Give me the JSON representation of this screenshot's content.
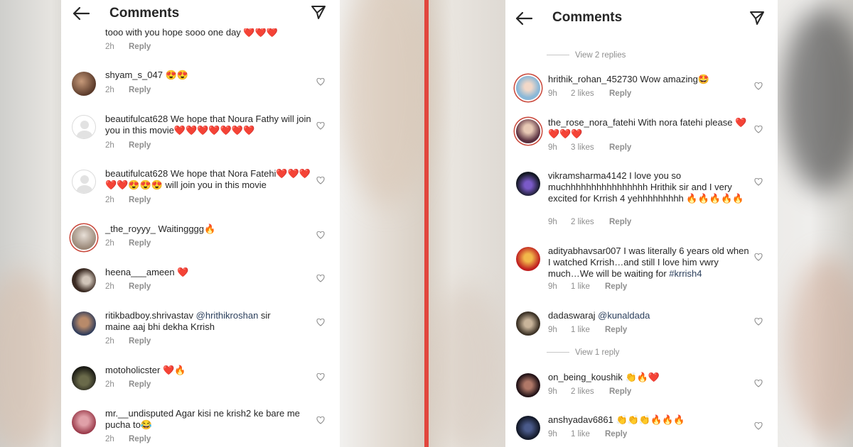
{
  "panels": [
    {
      "header": {
        "title": "Comments"
      },
      "comments": [
        {
          "text": "tooo with you hope sooo one day ❤️❤️❤️",
          "time": "2h",
          "reply": "Reply"
        },
        {
          "user": "shyam_s_047",
          "text": "😍😍",
          "time": "2h",
          "reply": "Reply"
        },
        {
          "user": "beautifulcat628",
          "text": "We hope that Noura Fathy will join you in this movie❤️❤️❤️❤️❤️❤️❤️",
          "time": "2h",
          "reply": "Reply"
        },
        {
          "user": "beautifulcat628",
          "text": "We hope that Nora Fatehi❤️❤️❤️❤️❤️😍😍😍 will join you in this movie",
          "time": "2h",
          "reply": "Reply"
        },
        {
          "user": "_the_royyy_",
          "text": "Waitingggg🔥",
          "time": "2h",
          "reply": "Reply"
        },
        {
          "user": "heena___ameen",
          "text": "❤️",
          "time": "2h",
          "reply": "Reply"
        },
        {
          "user": "ritikbadboy.shrivastav",
          "mention": "@hrithikroshan",
          "text": "sir maine aaj bhi dekha Krrish",
          "time": "2h",
          "reply": "Reply"
        },
        {
          "user": "motoholicster",
          "text": "❤️🔥",
          "time": "2h",
          "reply": "Reply"
        },
        {
          "user": "mr.__undisputed",
          "text": "Agar kisi ne krish2 ke bare me pucha to😂",
          "time": "2h",
          "reply": "Reply"
        }
      ]
    },
    {
      "header": {
        "title": "Comments"
      },
      "view_replies_top": "View 2 replies",
      "view_replies_mid": "View 1 reply",
      "comments": [
        {
          "user": "hrithik_rohan_452730",
          "text": "Wow amazing🤩",
          "time": "9h",
          "likes": "2 likes",
          "reply": "Reply"
        },
        {
          "user": "the_rose_nora_fatehi",
          "text": "With nora fatehi please ❤️❤️❤️❤️",
          "time": "9h",
          "likes": "3 likes",
          "reply": "Reply"
        },
        {
          "user": "vikramsharma4142",
          "text": "I love you so muchhhhhhhhhhhhhhhh Hrithik sir and I very excited for Krrish 4 yehhhhhhhhh 🔥🔥🔥🔥🔥",
          "time": "9h",
          "likes": "2 likes",
          "reply": "Reply"
        },
        {
          "user": "adityabhavsar007",
          "text": "I was literally 6 years old when I watched Krrish…and still I love him vwry much…We will be waiting for",
          "hashtag": "#krrish4",
          "time": "9h",
          "likes": "1 like",
          "reply": "Reply"
        },
        {
          "user": "dadaswaraj",
          "mention": "@kunaldada",
          "text": "",
          "time": "9h",
          "likes": "1 like",
          "reply": "Reply"
        },
        {
          "user": "on_being_koushik",
          "text": "👏🔥❤️",
          "time": "9h",
          "likes": "2 likes",
          "reply": "Reply"
        },
        {
          "user": "anshyadav6861",
          "text": "👏👏👏🔥🔥🔥",
          "time": "9h",
          "likes": "1 like",
          "reply": "Reply"
        }
      ]
    }
  ],
  "colors": {
    "divider": "#e1463d",
    "meta": "#8e8e8e",
    "mention": "#2b3f5c"
  }
}
